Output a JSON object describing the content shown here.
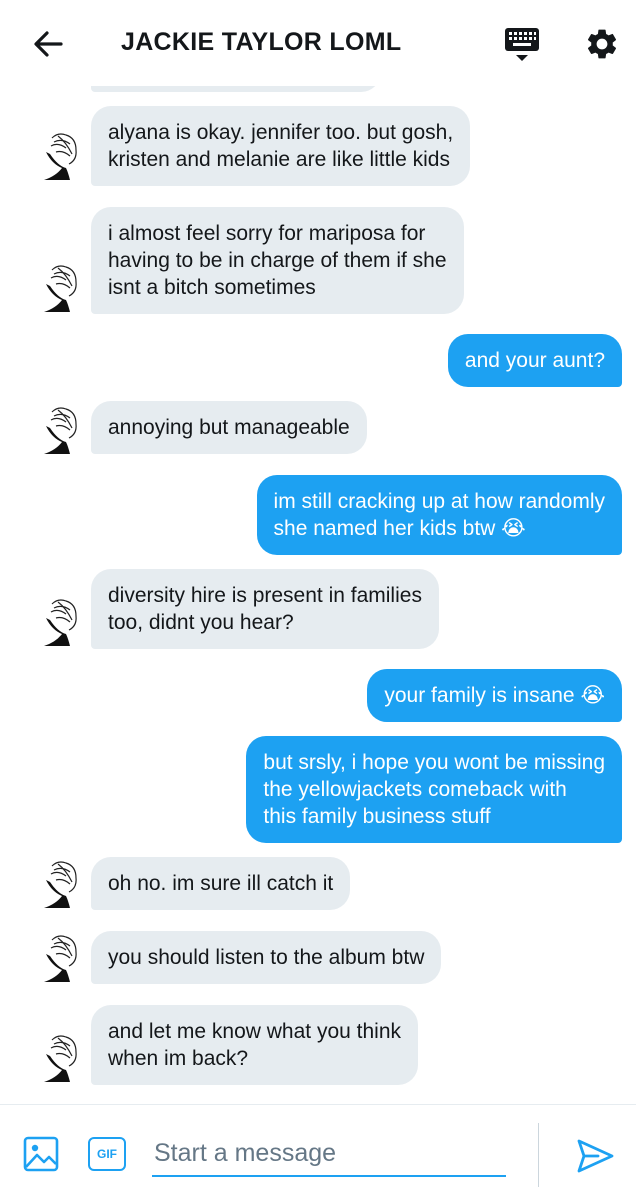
{
  "header": {
    "title": "JACKIE TAYLOR LOML",
    "back_icon": "arrow-left-icon",
    "keyboard_icon": "keyboard-icon",
    "settings_icon": "gear-icon"
  },
  "colors": {
    "accent": "#1da1f2",
    "incoming_bubble": "#e6ecf0",
    "outgoing_text": "#ffffff",
    "text": "#14171a",
    "placeholder": "#657786"
  },
  "messages": [
    {
      "side": "in",
      "text": "alyana is okay. jennifer too. but gosh,\nkristen and melanie are like little kids"
    },
    {
      "side": "in",
      "text": "i almost feel sorry for mariposa for\nhaving to be in charge of them if she\nisnt a bitch sometimes"
    },
    {
      "side": "out",
      "text": "and your aunt?"
    },
    {
      "side": "in",
      "text": "annoying but manageable"
    },
    {
      "side": "out",
      "text": "im still cracking up at how randomly\nshe named her kids btw 😭"
    },
    {
      "side": "in",
      "text": "diversity hire is present in families\ntoo, didnt you hear?"
    },
    {
      "side": "out",
      "text": "your family is insane 😭"
    },
    {
      "side": "out",
      "text": "but srsly, i hope you wont be missing\nthe yellowjackets comeback with\nthis family business stuff"
    },
    {
      "side": "in",
      "text": "oh no. im sure ill catch it"
    },
    {
      "side": "in",
      "text": "you should listen to the album btw"
    },
    {
      "side": "in",
      "text": "and let me know what you think\nwhen im back?"
    }
  ],
  "composer": {
    "placeholder": "Start a message",
    "gif_label": "GIF",
    "image_icon": "image-icon",
    "send_icon": "send-icon"
  }
}
